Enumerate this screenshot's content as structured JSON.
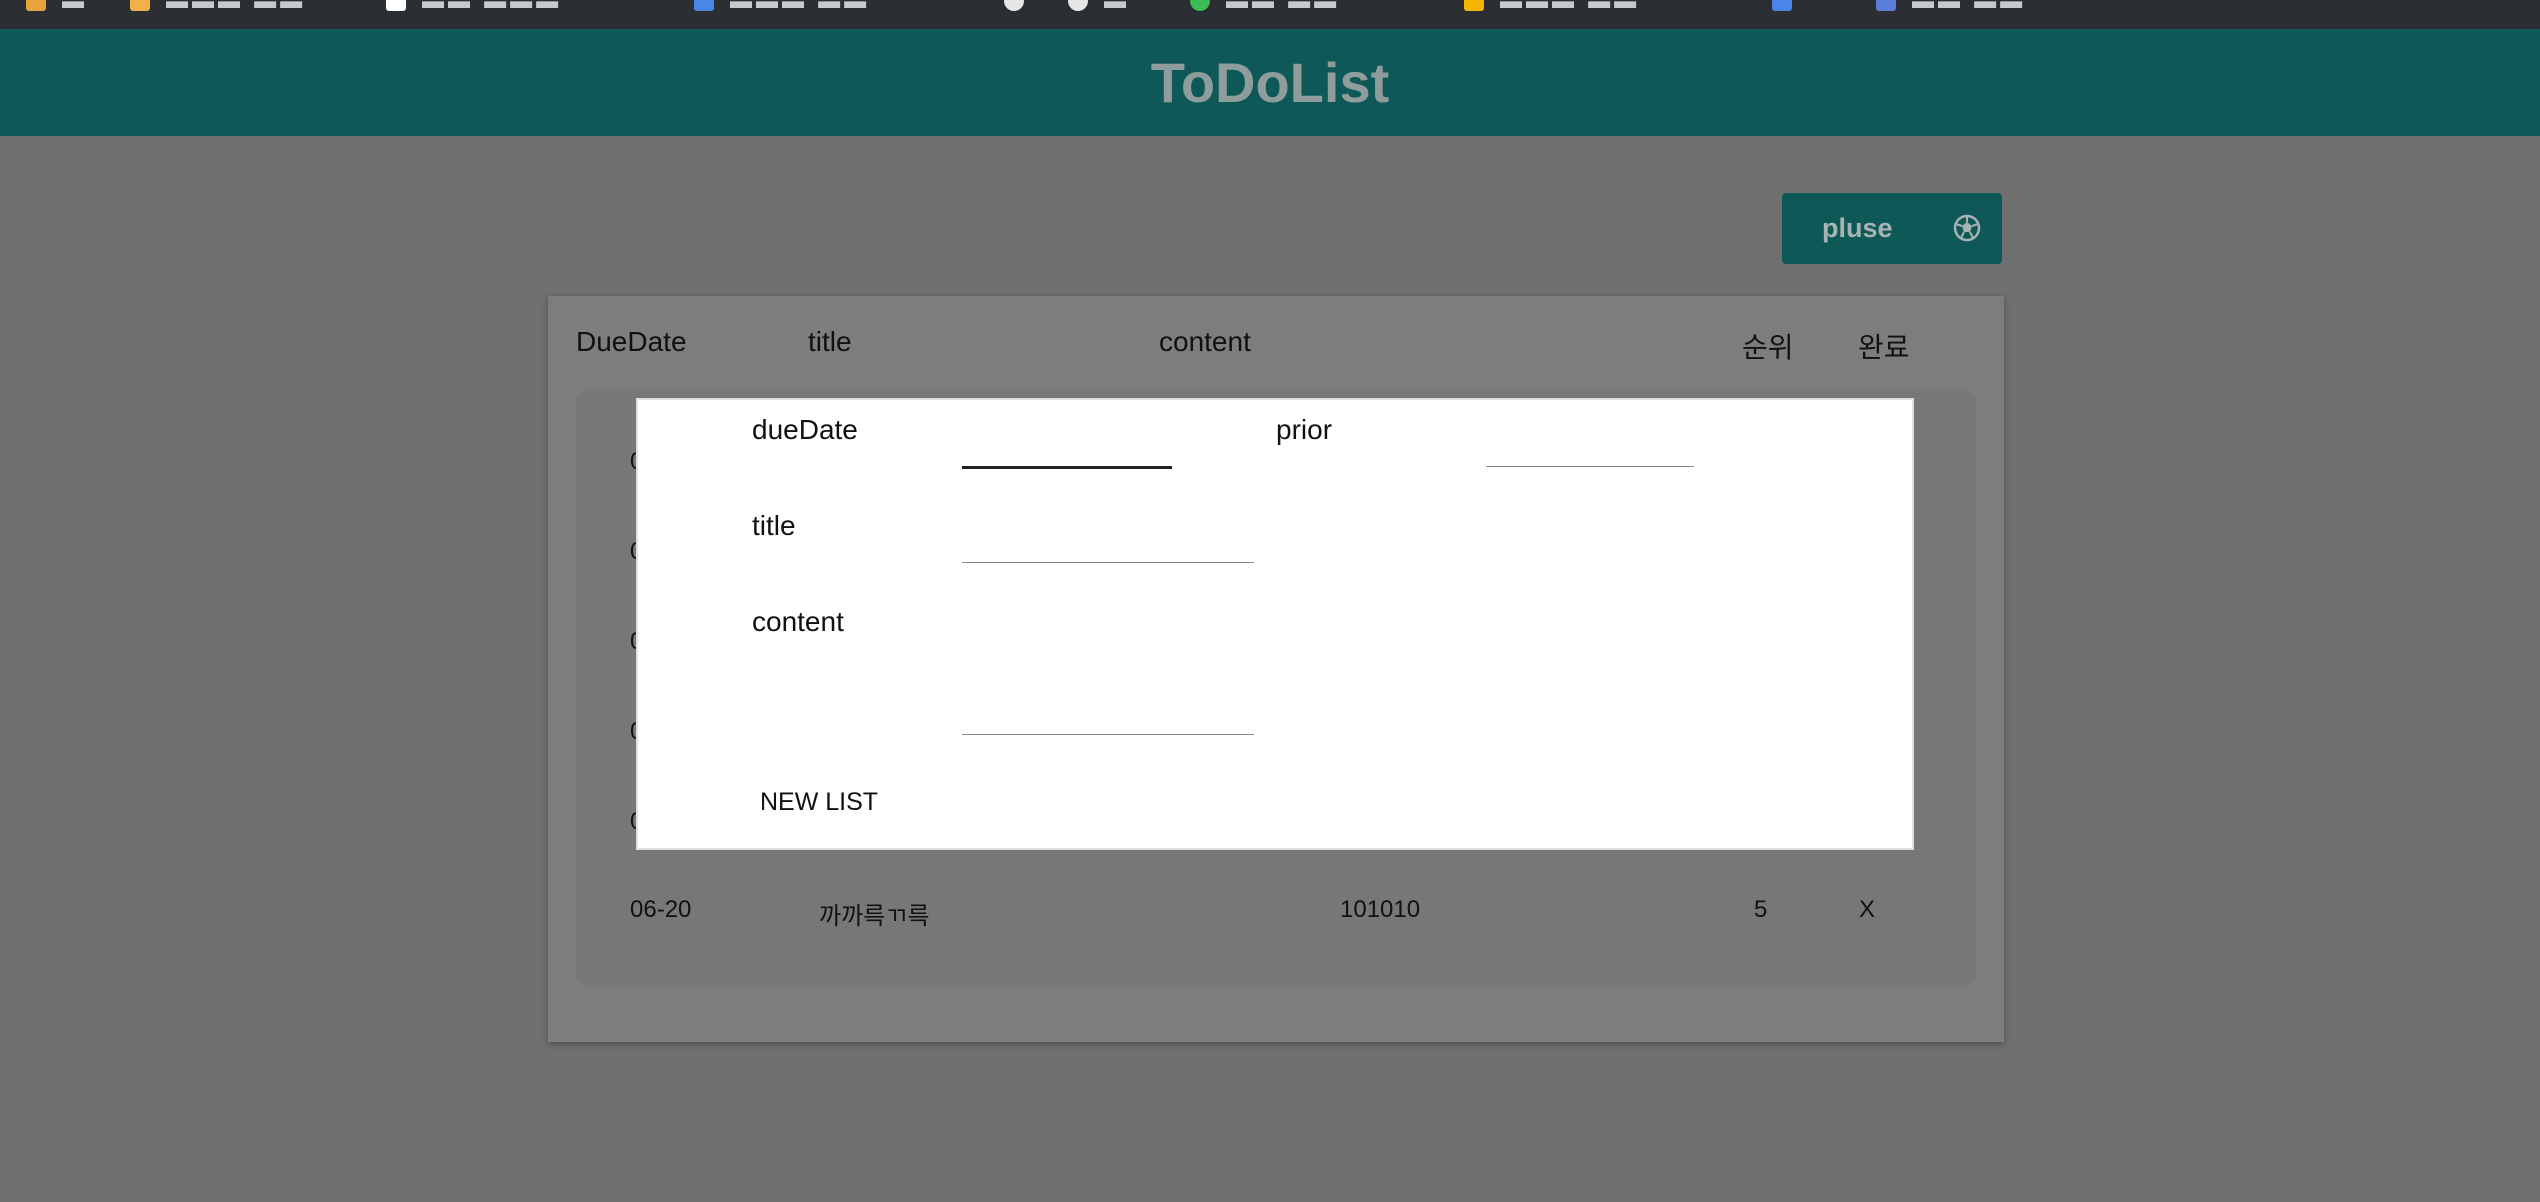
{
  "app": {
    "title": "ToDoList",
    "add_button_label": "pluse"
  },
  "table": {
    "headers": {
      "due_date": "DueDate",
      "title": "title",
      "content": "content",
      "priority": "순위",
      "done": "완료"
    },
    "peek_rows": [
      "0",
      "0",
      "0",
      "0",
      "0"
    ],
    "last_row": {
      "due_date": "06-20",
      "title": "까까륵ㄲ륵",
      "content": "101010",
      "priority": "5",
      "done": "X"
    }
  },
  "modal": {
    "due_date_label": "dueDate",
    "prior_label": "prior",
    "title_label": "title",
    "content_label": "content",
    "submit_label": "NEW LIST"
  },
  "colors": {
    "header_bg": "#0e5957",
    "overlay_bg": "#707070",
    "modal_bg": "#ffffff"
  }
}
